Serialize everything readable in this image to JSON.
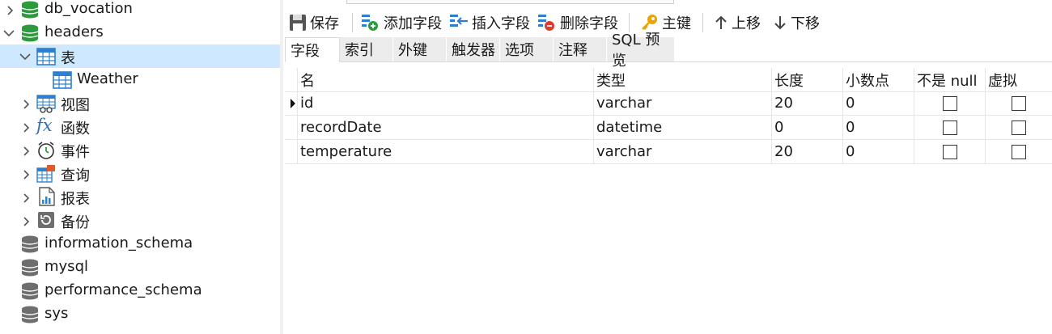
{
  "tree": {
    "items": [
      {
        "label": "db_vocation",
        "icon": "database-icon",
        "expanded": false
      },
      {
        "label": "headers",
        "icon": "database-icon",
        "expanded": true
      },
      {
        "label": "表",
        "icon": "table-group-icon",
        "expanded": true,
        "selected": true
      },
      {
        "label": "Weather",
        "icon": "table-icon"
      },
      {
        "label": "视图",
        "icon": "view-icon",
        "expanded": false
      },
      {
        "label": "函数",
        "icon": "function-icon",
        "expanded": false
      },
      {
        "label": "事件",
        "icon": "event-clock-icon",
        "expanded": false
      },
      {
        "label": "查询",
        "icon": "query-icon",
        "expanded": false
      },
      {
        "label": "报表",
        "icon": "report-icon",
        "expanded": false
      },
      {
        "label": "备份",
        "icon": "backup-icon",
        "expanded": false
      },
      {
        "label": "information_schema",
        "icon": "database-gray-icon"
      },
      {
        "label": "mysql",
        "icon": "database-gray-icon"
      },
      {
        "label": "performance_schema",
        "icon": "database-gray-icon"
      },
      {
        "label": "sys",
        "icon": "database-gray-icon"
      }
    ]
  },
  "toolbar": {
    "save": "保存",
    "add_field": "添加字段",
    "insert_field": "插入字段",
    "delete_field": "删除字段",
    "primary_key": "主键",
    "move_up": "上移",
    "move_down": "下移"
  },
  "tabs": [
    "字段",
    "索引",
    "外键",
    "触发器",
    "选项",
    "注释",
    "SQL 预览"
  ],
  "grid": {
    "columns": [
      "名",
      "类型",
      "长度",
      "小数点",
      "不是 null",
      "虚拟"
    ],
    "rows": [
      {
        "name": "id",
        "type": "varchar",
        "length": "20",
        "decimals": "0",
        "not_null": false,
        "virtual": false,
        "current": true
      },
      {
        "name": "recordDate",
        "type": "datetime",
        "length": "0",
        "decimals": "0",
        "not_null": false,
        "virtual": false
      },
      {
        "name": "temperature",
        "type": "varchar",
        "length": "20",
        "decimals": "0",
        "not_null": false,
        "virtual": false
      }
    ]
  },
  "colors": {
    "db_active": "#2e9a3e",
    "db_inactive": "#6e6e6e",
    "selection": "#cde8ff",
    "table_icon": "#2f7fd1",
    "key_icon": "#e8a500"
  }
}
